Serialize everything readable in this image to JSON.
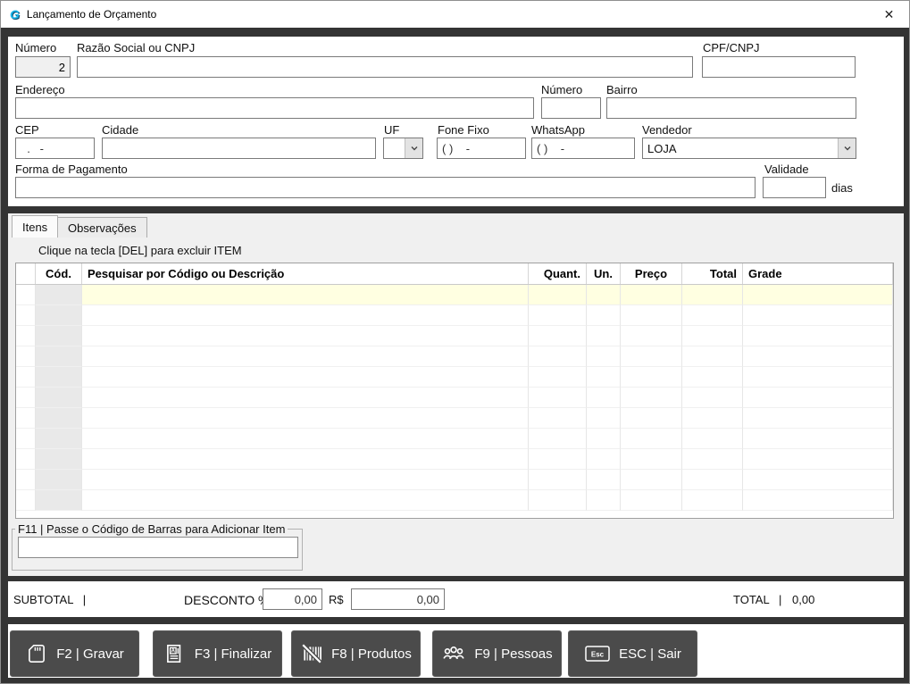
{
  "window": {
    "title": "Lançamento de Orçamento",
    "close_glyph": "✕",
    "app_initial": "G"
  },
  "form": {
    "numero_label": "Número",
    "numero_value": "2",
    "razao_label": "Razão Social ou CNPJ",
    "razao_value": "",
    "cpf_label": "CPF/CNPJ",
    "cpf_value": "",
    "endereco_label": "Endereço",
    "endereco_value": "",
    "numero_end_label": "Número",
    "numero_end_value": "",
    "bairro_label": "Bairro",
    "bairro_value": "",
    "cep_label": "CEP",
    "cep_value": "  .   -",
    "cidade_label": "Cidade",
    "cidade_value": "",
    "uf_label": "UF",
    "uf_value": "",
    "fone_label": "Fone Fixo",
    "fone_value": "( )    -",
    "whatsapp_label": "WhatsApp",
    "whatsapp_value": "( )    -",
    "vendedor_label": "Vendedor",
    "vendedor_value": "LOJA",
    "forma_label": "Forma de Pagamento",
    "forma_value": "",
    "validade_label": "Validade",
    "validade_value": "",
    "validade_suffix": "dias"
  },
  "tabs": {
    "itens": "Itens",
    "observacoes": "Observações"
  },
  "items": {
    "hint": "Clique na tecla [DEL] para excluir ITEM",
    "columns": [
      "Cód.",
      "Pesquisar por Código ou Descrição",
      "Quant.",
      "Un.",
      "Preço",
      "Total",
      "Grade"
    ],
    "empty_row_count": 11
  },
  "barcode": {
    "legend": "F11 | Passe o Código de Barras para Adicionar Item",
    "value": ""
  },
  "totals": {
    "subtotal_label": "SUBTOTAL   |",
    "desconto_label": "DESCONTO %",
    "desconto_pct": "0,00",
    "currency": "R$",
    "desconto_valor": "0,00",
    "total_label": "TOTAL   |",
    "total_value": "0,00"
  },
  "actions": {
    "gravar": "F2 | Gravar",
    "finalizar": "F3 | Finalizar",
    "produtos": "F8 | Produtos",
    "pessoas": "F9 | Pessoas",
    "sair": "ESC | Sair",
    "esc_key": "Esc"
  },
  "colors": {
    "frame": "#343434",
    "button_bg": "#4b4b4b",
    "row_highlight": "#ffffe1",
    "cod_column": "#e9e9e9",
    "app_icon": "#1ab4e8"
  }
}
